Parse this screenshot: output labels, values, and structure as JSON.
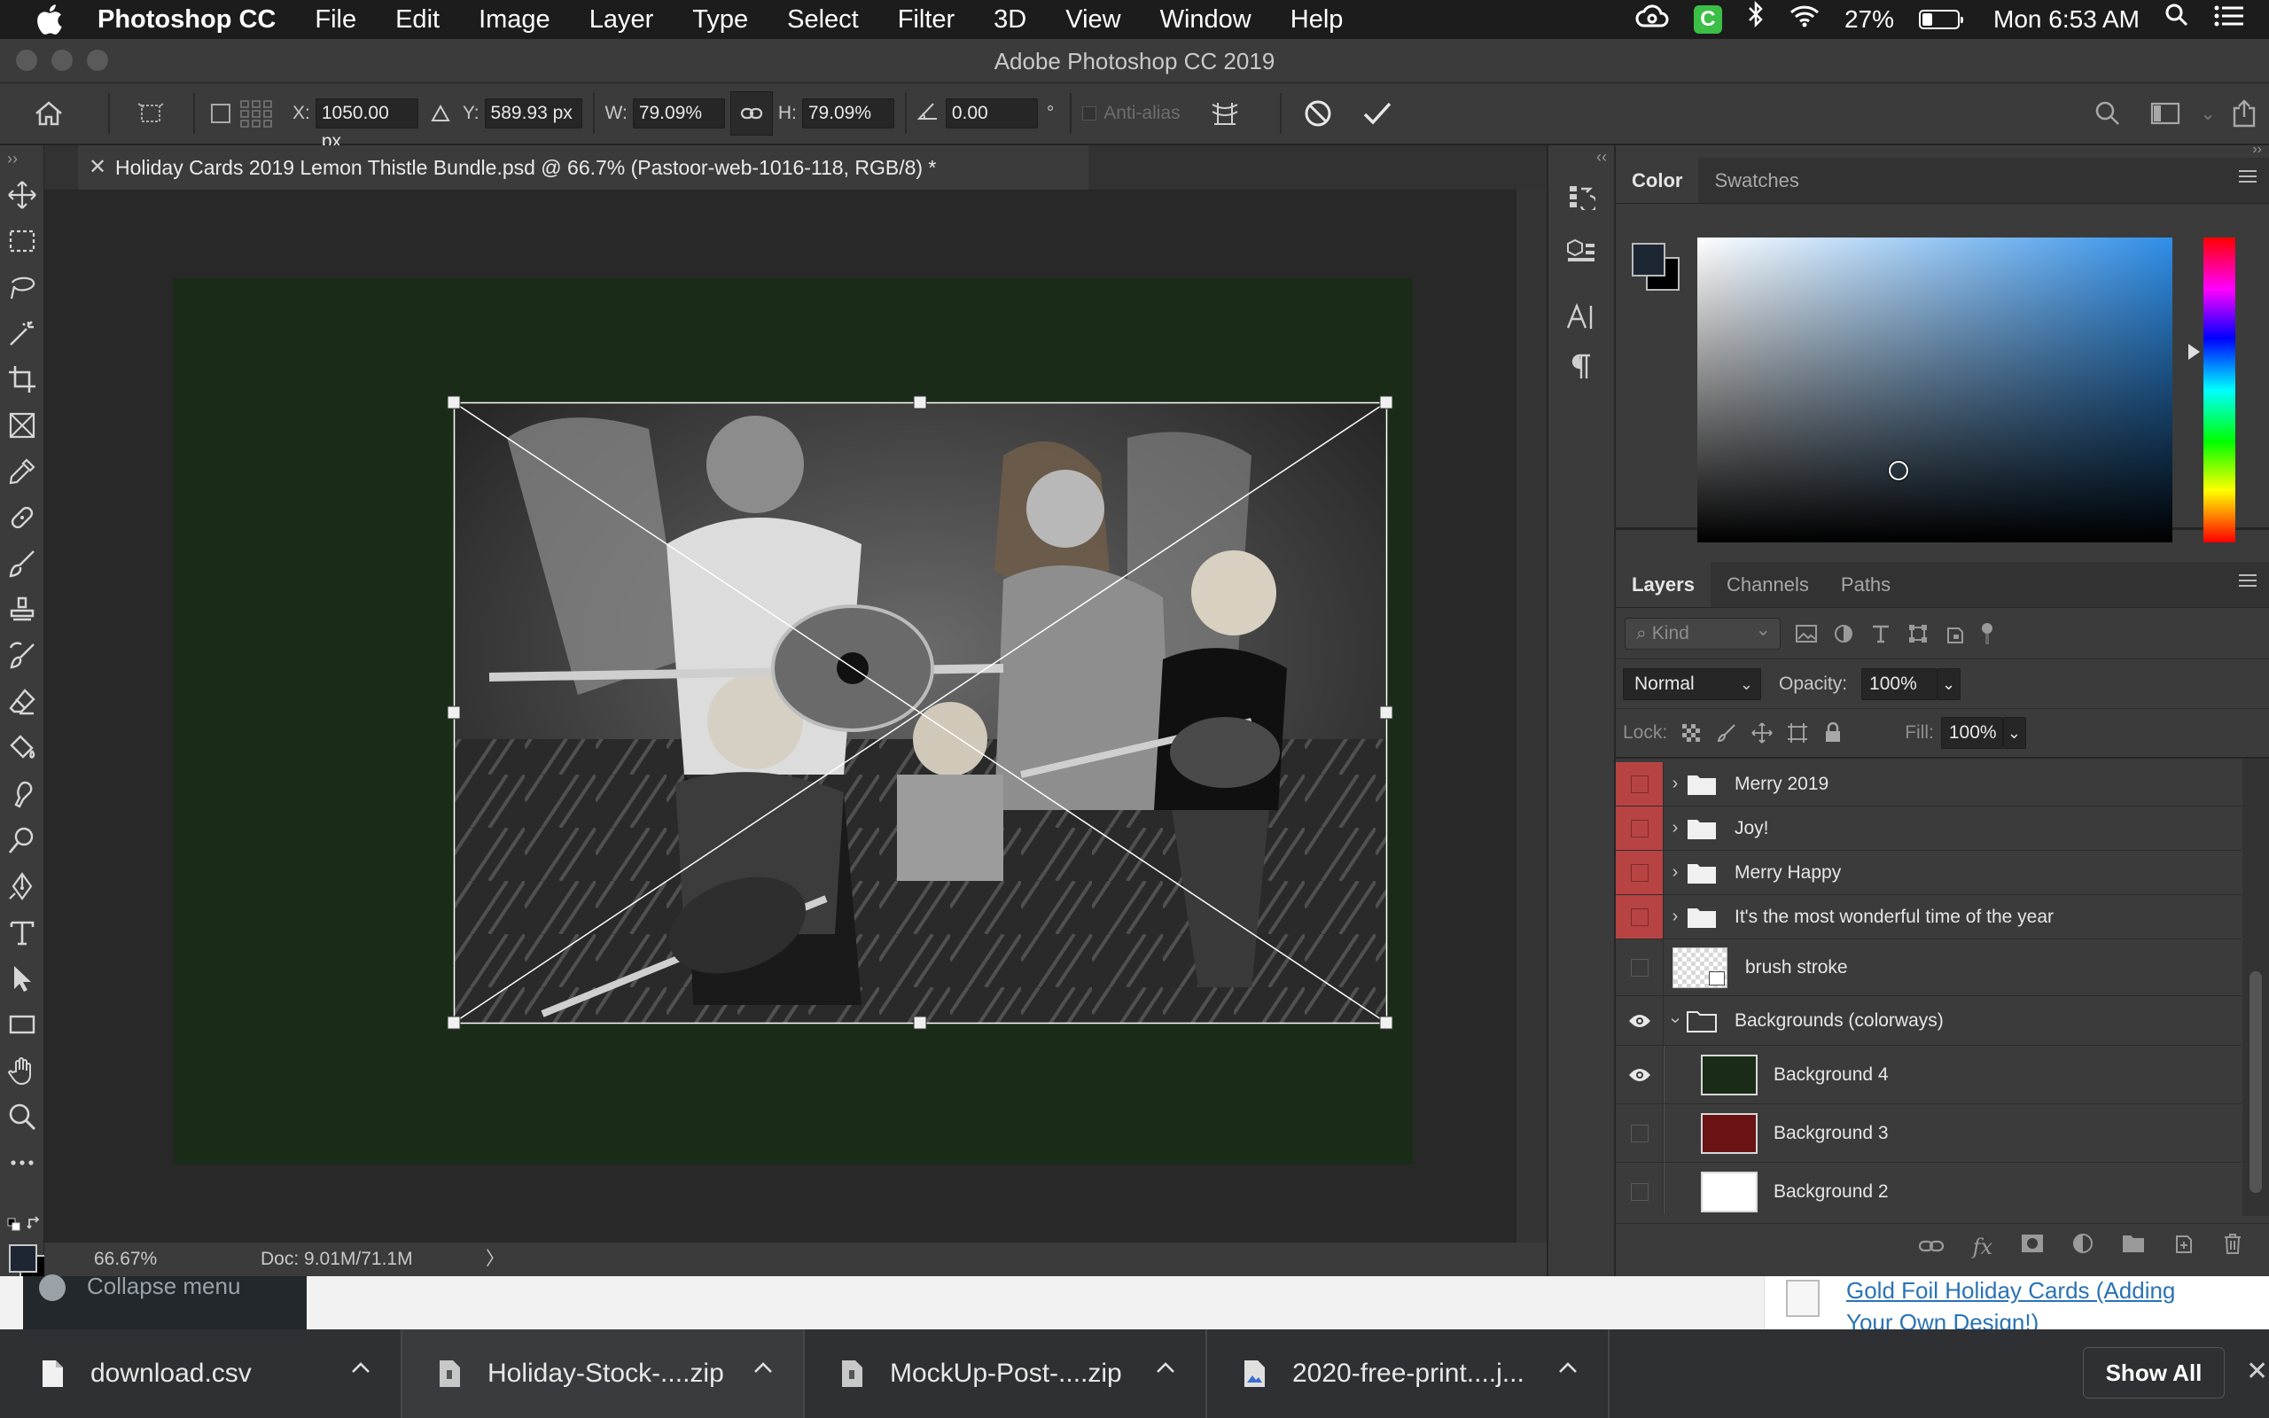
{
  "menubar": {
    "app": "Photoshop CC",
    "items": [
      "File",
      "Edit",
      "Image",
      "Layer",
      "Type",
      "Select",
      "Filter",
      "3D",
      "View",
      "Window",
      "Help"
    ],
    "battery": "27%",
    "clock": "Mon 6:53 AM"
  },
  "window": {
    "title": "Adobe Photoshop CC 2019"
  },
  "options": {
    "x_label": "X:",
    "x_value": "1050.00 px",
    "y_label": "Y:",
    "y_value": "589.93 px",
    "w_label": "W:",
    "w_value": "79.09%",
    "h_label": "H:",
    "h_value": "79.09%",
    "angle_value": "0.00",
    "angle_unit": "°",
    "antialias": "Anti-alias"
  },
  "document": {
    "tab_title": "Holiday Cards 2019 Lemon Thistle Bundle.psd @ 66.7% (Pastoor-web-1016-118, RGB/8) *",
    "zoom": "66.67%",
    "doc_size": "Doc: 9.01M/71.1M",
    "canvas_bg": "#1a2c18"
  },
  "color_panel": {
    "tabs": [
      "Color",
      "Swatches"
    ],
    "foreground": "#1c2733",
    "background": "#000000"
  },
  "layers_panel": {
    "tabs": [
      "Layers",
      "Channels",
      "Paths"
    ],
    "kind_placeholder": "Kind",
    "blend_mode": "Normal",
    "opacity_label": "Opacity:",
    "opacity_value": "100%",
    "lock_label": "Lock:",
    "fill_label": "Fill:",
    "fill_value": "100%",
    "layers": [
      {
        "name": "Merry 2019",
        "type": "group",
        "visible": false,
        "color": "red"
      },
      {
        "name": "Joy!",
        "type": "group",
        "visible": false,
        "color": "red"
      },
      {
        "name": "Merry Happy",
        "type": "group",
        "visible": false,
        "color": "red"
      },
      {
        "name": "It's the most wonderful time of the year",
        "type": "group",
        "visible": false,
        "color": "red"
      },
      {
        "name": "brush stroke",
        "type": "smart",
        "visible": false
      },
      {
        "name": "Backgrounds (colorways)",
        "type": "group-open",
        "visible": true
      },
      {
        "name": "Background 4",
        "type": "fill",
        "visible": true,
        "swatch": "#1a2c18"
      },
      {
        "name": "Background 3",
        "type": "fill",
        "visible": false,
        "swatch": "#6a1214"
      },
      {
        "name": "Background 2",
        "type": "fill",
        "visible": false,
        "swatch": "#ffffff"
      }
    ]
  },
  "browser": {
    "collapse_menu": "Collapse menu",
    "link": "Gold Foil Holiday Cards (Adding Your Own Design!)"
  },
  "downloads": {
    "items": [
      "download.csv",
      "Holiday-Stock-....zip",
      "MockUp-Post-....zip",
      "2020-free-print....j..."
    ],
    "show_all": "Show All"
  }
}
